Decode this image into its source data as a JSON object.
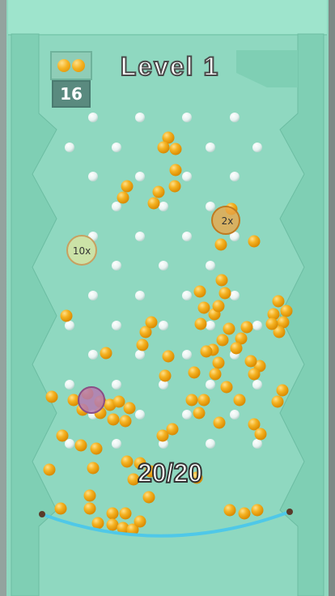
{
  "hud": {
    "level_title": "Level 1",
    "balls_remaining": "16",
    "balls_icon": "gold-balls-icon"
  },
  "multipliers": {
    "left_label": "10x",
    "right_label": "2x"
  },
  "progress": {
    "text": "20/20"
  },
  "colors": {
    "board": "#8fd8c0",
    "walls": "#7fcfb4",
    "ball": "#f5b323",
    "peg": "#ffffff",
    "rope": "#4fc8e8"
  }
}
